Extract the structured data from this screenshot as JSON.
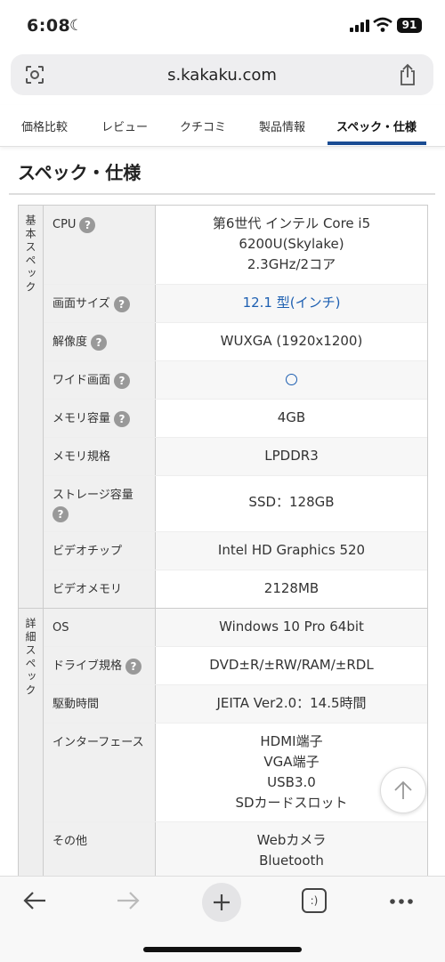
{
  "status": {
    "time": "6:08",
    "battery": "91"
  },
  "browser": {
    "url": "s.kakaku.com"
  },
  "tabs": [
    "価格比較",
    "レビュー",
    "クチコミ",
    "製品情報",
    "スペック・仕様"
  ],
  "heading": "スペック・仕様",
  "sections": {
    "basic": {
      "label": "基本スペック",
      "rows": [
        {
          "label": "CPU",
          "value": [
            "第6世代 インテル Core i5",
            "6200U(Skylake)",
            "2.3GHz/2コア"
          ]
        },
        {
          "label": "画面サイズ",
          "value": [
            "12.1 型(インチ)"
          ]
        },
        {
          "label": "解像度",
          "value": [
            "WUXGA (1920x1200)"
          ]
        },
        {
          "label": "ワイド画面",
          "value": [
            "○"
          ]
        },
        {
          "label": "メモリ容量",
          "value": [
            "4GB"
          ]
        },
        {
          "label": "メモリ規格",
          "value": [
            "LPDDR3"
          ]
        },
        {
          "label": "ストレージ容量",
          "value": [
            "SSD：128GB"
          ]
        },
        {
          "label": "ビデオチップ",
          "value": [
            "Intel HD Graphics 520"
          ]
        },
        {
          "label": "ビデオメモリ",
          "value": [
            "2128MB"
          ]
        }
      ]
    },
    "detail": {
      "label": "詳細スペック",
      "rows": [
        {
          "label": "OS",
          "value": [
            "Windows 10 Pro 64bit"
          ]
        },
        {
          "label": "ドライブ規格",
          "value": [
            "DVD±R/±RW/RAM/±RDL"
          ]
        },
        {
          "label": "駆動時間",
          "value": [
            "JEITA Ver2.0：14.5時間"
          ]
        },
        {
          "label": "インターフェース",
          "value": [
            "HDMI端子",
            "VGA端子",
            "USB3.0",
            "SDカードスロット"
          ]
        },
        {
          "label": "その他",
          "value": [
            "Webカメラ",
            "Bluetooth"
          ]
        }
      ]
    }
  },
  "help_mark": "?",
  "bottom_bar": {
    "tabs_icon_label": ":)"
  }
}
